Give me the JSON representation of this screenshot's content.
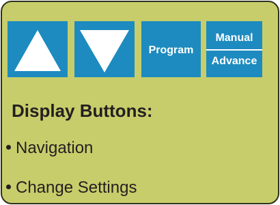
{
  "buttons": {
    "up": {
      "icon": "arrow-up-icon"
    },
    "down": {
      "icon": "arrow-down-icon"
    },
    "program": {
      "label": "Program"
    },
    "manual_advance": {
      "top_label": "Manual",
      "bottom_label": "Advance"
    }
  },
  "section": {
    "heading": "Display Buttons:",
    "items": [
      {
        "label": "Navigation"
      },
      {
        "label": "Change Settings"
      }
    ]
  },
  "colors": {
    "panel_background": "#c7cd6a",
    "button_blue": "#1d8bbf",
    "text": "#231f20"
  }
}
